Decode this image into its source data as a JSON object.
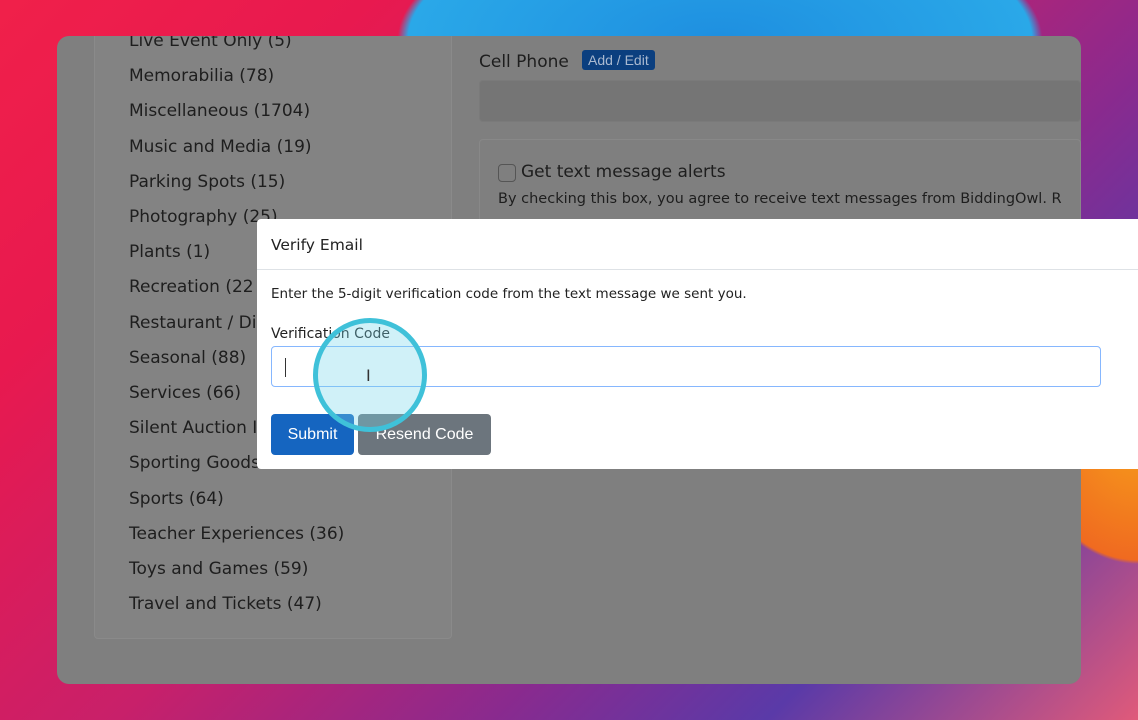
{
  "sidebar": {
    "categories": [
      "Live Event Only (5)",
      "Memorabilia (78)",
      "Miscellaneous (1704)",
      "Music and Media (19)",
      "Parking Spots (15)",
      "Photography (25)",
      "Plants (1)",
      "Recreation (22",
      "Restaurant / Di",
      "Seasonal (88)",
      "Services (66)",
      "Silent Auction I",
      "Sporting Goods",
      "Sports (64)",
      "Teacher Experiences (36)",
      "Toys and Games (59)",
      "Travel and Tickets (47)"
    ]
  },
  "main": {
    "cell_phone_label": "Cell Phone",
    "add_edit_label": "Add / Edit",
    "text_alerts_label": "Get text message alerts",
    "text_alerts_desc": "By checking this box, you agree to receive text messages from BiddingOwl. R"
  },
  "modal": {
    "title": "Verify Email",
    "instructions": "Enter the 5-digit verification code from the text message we sent you.",
    "code_label": "Verification Code",
    "code_value": "",
    "submit_label": "Submit",
    "resend_label": "Resend Code"
  },
  "colors": {
    "primary": "#1565c0",
    "secondary": "#6c757d",
    "cursor_highlight": "#3fc1d9"
  }
}
